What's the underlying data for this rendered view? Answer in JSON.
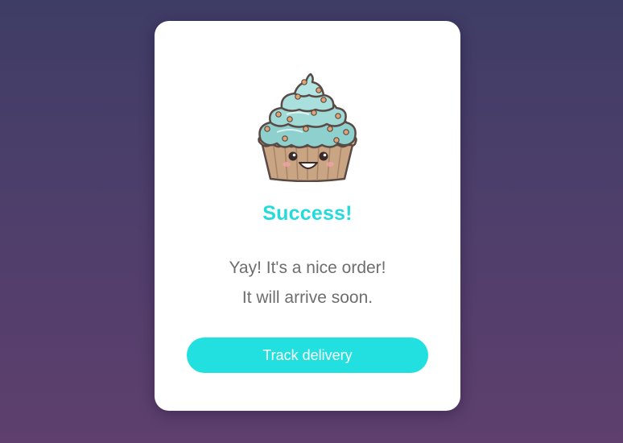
{
  "dialog": {
    "title": "Success!",
    "message_line1": "Yay! It's a nice order!",
    "message_line2": "It will arrive soon.",
    "button_label": "Track delivery",
    "illustration": "cupcake-illustration"
  },
  "colors": {
    "accent": "#25dbd9",
    "button": "#22e0e0",
    "text": "#6e6e6e",
    "background_top": "#3e3d66",
    "background_bottom": "#5e3f6d"
  }
}
